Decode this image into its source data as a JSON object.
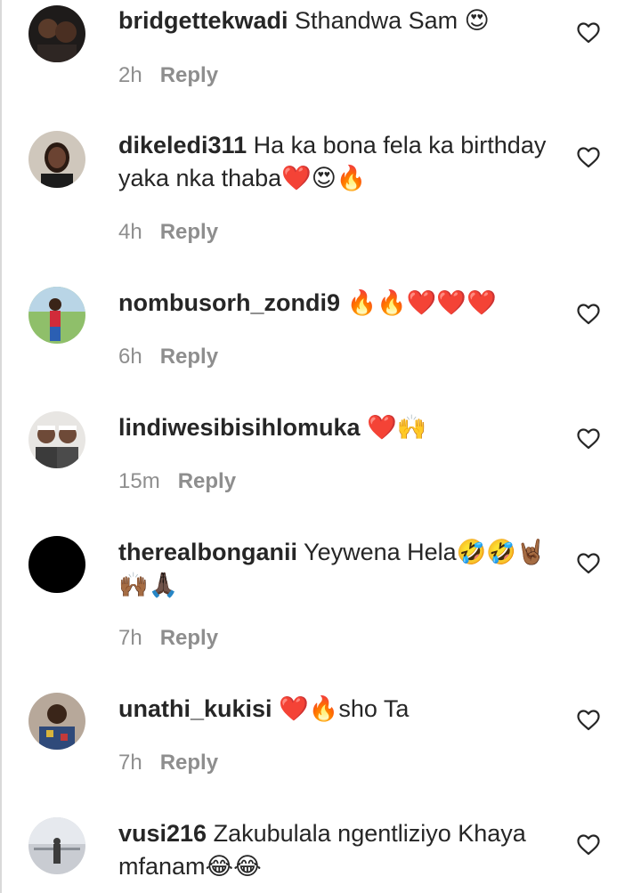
{
  "comments": [
    {
      "username": "bridgettekwadi",
      "text": "Sthandwa Sam",
      "emojis": "😍",
      "time": "2h",
      "reply": "Reply"
    },
    {
      "username": "dikeledi311",
      "text": "Ha ka bona fela ka birthday yaka nka thaba",
      "emojis": "❤️😍🔥",
      "time": "4h",
      "reply": "Reply"
    },
    {
      "username": "nombusorh_zondi9",
      "text": "",
      "emojis": "🔥🔥❤️❤️❤️",
      "time": "6h",
      "reply": "Reply"
    },
    {
      "username": "lindiwesibisihlomuka",
      "text": "",
      "emojis": "❤️🙌",
      "time": "15m",
      "reply": "Reply"
    },
    {
      "username": "therealbonganii",
      "text": "Yeywena Hela",
      "emojis": "🤣🤣🤘🏾🙌🏾🙏🏿",
      "time": "7h",
      "reply": "Reply"
    },
    {
      "username": "unathi_kukisi",
      "text": "sho Ta",
      "emojis": "❤️🔥",
      "time": "7h",
      "reply": "Reply"
    },
    {
      "username": "vusi216",
      "text": "Zakubulala ngentliziyo Khaya mfanam",
      "emojis": "😂😂",
      "time": "",
      "reply": ""
    }
  ],
  "colors": {
    "text": "#262626",
    "meta": "#8e8e8e",
    "heart_outline": "#262626"
  },
  "icons": {
    "like": "heart-outline-icon"
  }
}
